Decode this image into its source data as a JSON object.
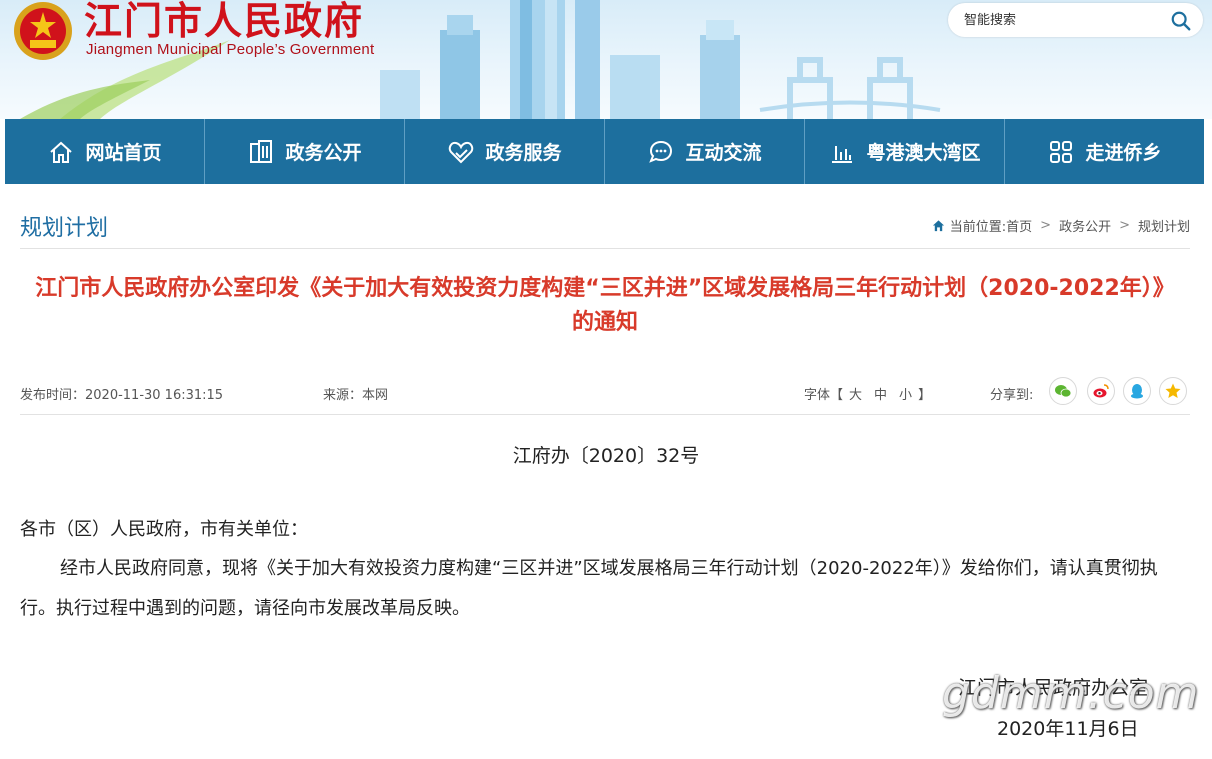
{
  "header": {
    "site_title": "江门市人民政府",
    "site_subtitle": "Jiangmen Municipal People’s Government",
    "search_placeholder": "智能搜索"
  },
  "nav": [
    {
      "label": "网站首页",
      "icon": "home-icon"
    },
    {
      "label": "政务公开",
      "icon": "building-icon"
    },
    {
      "label": "政务服务",
      "icon": "heart-hands-icon"
    },
    {
      "label": "互动交流",
      "icon": "chat-bubbles-icon"
    },
    {
      "label": "粤港澳大湾区",
      "icon": "bar-chart-icon"
    },
    {
      "label": "走进侨乡",
      "icon": "grid-icon"
    }
  ],
  "section": {
    "title": "规划计划",
    "breadcrumb_prefix": "当前位置:",
    "crumbs": [
      "首页",
      "政务公开",
      "规划计划"
    ],
    "separator": ">"
  },
  "article": {
    "title": "江门市人民政府办公室印发《关于加大有效投资力度构建“三区并进”区域发展格局三年行动计划（2020-2022年）》的通知",
    "publish_time": "发布时间：2020-11-30 16:31:15",
    "source": "来源：本网",
    "font_label_open": "字体【",
    "font_sizes": [
      "大",
      "中",
      "小"
    ],
    "font_label_close": "】",
    "share_label": "分享到:",
    "share_targets": [
      "wechat-icon",
      "weibo-icon",
      "qq-icon",
      "qzone-icon"
    ],
    "doc_number": "江府办〔2020〕32号",
    "salutation": "各市（区）人民政府，市有关单位：",
    "body": "经市人民政府同意，现将《关于加大有效投资力度构建“三区并进”区域发展格局三年行动计划（2020-2022年）》发给你们，请认真贯彻执行。执行过程中遇到的问题，请径向市发展改革局反映。",
    "signer": "江门市人民政府办公室",
    "date": "2020年11月6日"
  },
  "watermark": "gdmm.com",
  "colors": {
    "nav_bg": "#1d6f9e",
    "title_red": "#d83a2a",
    "site_red": "#d0121b",
    "section_blue": "#1f6ea3"
  }
}
